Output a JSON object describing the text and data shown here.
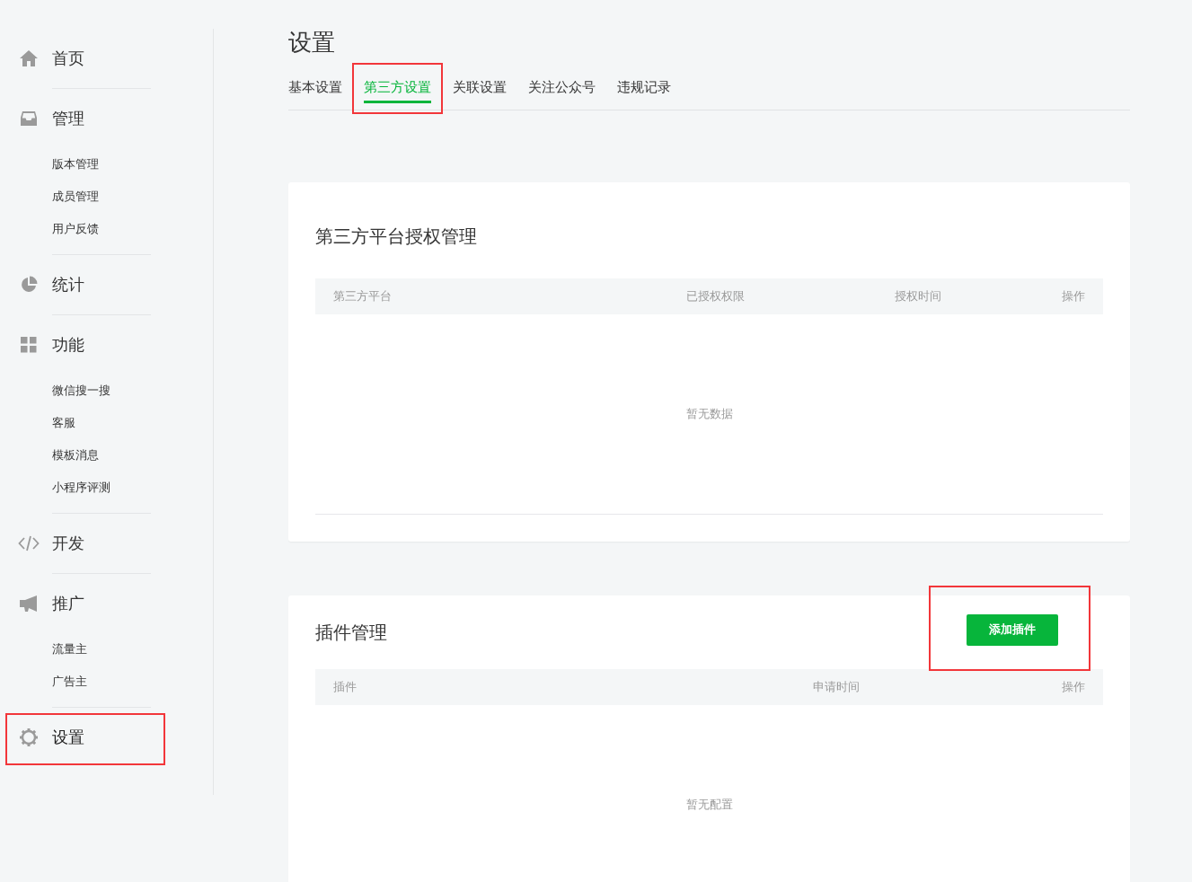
{
  "sidebar": {
    "groups": [
      {
        "label": "首页",
        "selected": false,
        "highlighted": false
      },
      {
        "label": "管理",
        "selected": false,
        "highlighted": false,
        "children": [
          "版本管理",
          "成员管理",
          "用户反馈"
        ]
      },
      {
        "label": "统计",
        "selected": false,
        "highlighted": false
      },
      {
        "label": "功能",
        "selected": false,
        "highlighted": false,
        "children": [
          "微信搜一搜",
          "客服",
          "模板消息",
          "小程序评测"
        ]
      },
      {
        "label": "开发",
        "selected": false,
        "highlighted": false
      },
      {
        "label": "推广",
        "selected": false,
        "highlighted": false,
        "children": [
          "流量主",
          "广告主"
        ]
      },
      {
        "label": "设置",
        "selected": true,
        "highlighted": true
      }
    ]
  },
  "page_title": "设置",
  "tabs": [
    {
      "label": "基本设置",
      "selected": false,
      "highlighted": false
    },
    {
      "label": "第三方设置",
      "selected": true,
      "highlighted": true
    },
    {
      "label": "关联设置",
      "selected": false,
      "highlighted": false
    },
    {
      "label": "关注公众号",
      "selected": false,
      "highlighted": false
    },
    {
      "label": "违规记录",
      "selected": false,
      "highlighted": false
    }
  ],
  "cards": [
    {
      "title": "第三方平台授权管理",
      "columns": [
        "第三方平台",
        "已授权权限",
        "授权时间",
        "操作"
      ],
      "empty_text": "暂无数据"
    },
    {
      "title": "插件管理",
      "button": {
        "label": "添加插件",
        "highlighted": true
      },
      "columns": [
        "插件",
        "申请时间",
        "操作"
      ],
      "empty_text": "暂无配置"
    }
  ]
}
